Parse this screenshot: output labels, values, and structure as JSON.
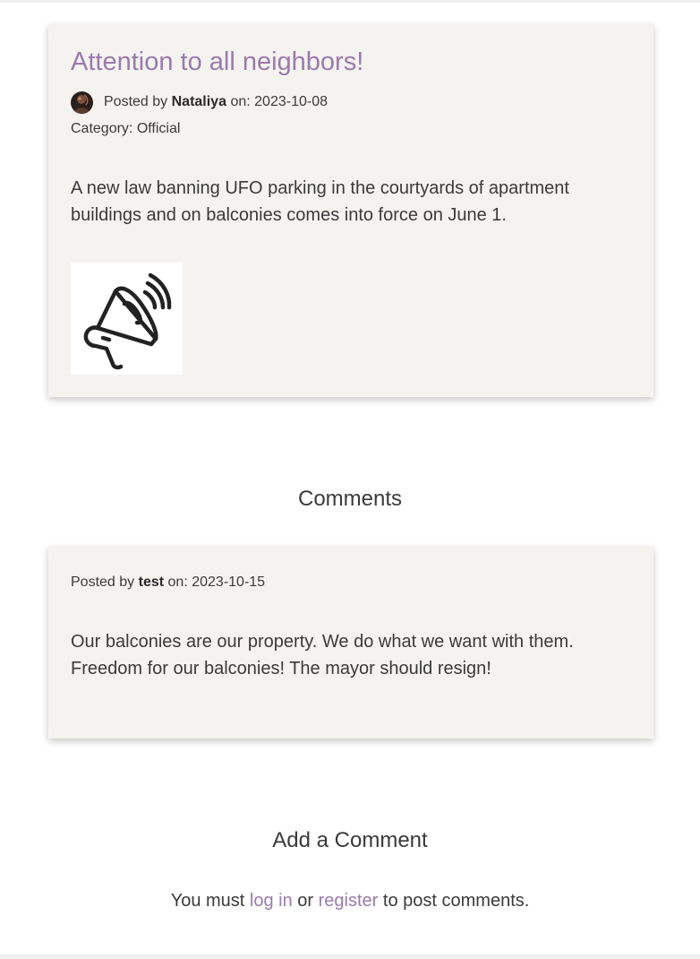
{
  "post": {
    "title": "Attention to all neighbors!",
    "posted_by_prefix": "Posted by",
    "author": "Nataliya",
    "on_label": "on:",
    "date": "2023-10-08",
    "category_label": "Category:",
    "category": "Official",
    "body": "A new law banning UFO parking in the courtyards of apartment buildings and on balconies comes into force on June 1.",
    "image_icon": "megaphone-icon",
    "avatar_icon": "user-avatar"
  },
  "comments_section": {
    "heading": "Comments",
    "items": [
      {
        "posted_by_prefix": "Posted by",
        "author": "test",
        "on_label": "on:",
        "date": "2023-10-15",
        "body": "Our balconies are our property. We do what we want with them. Freedom for our balconies! The mayor should resign!"
      }
    ]
  },
  "add_comment": {
    "heading": "Add a Comment",
    "prefix": "You must",
    "login_link": "log in",
    "middle": "or",
    "register_link": "register",
    "suffix": "to post comments."
  },
  "colors": {
    "accent": "#9b7aab",
    "card_background": "#f4f3f0",
    "text": "#3a3a3a"
  }
}
